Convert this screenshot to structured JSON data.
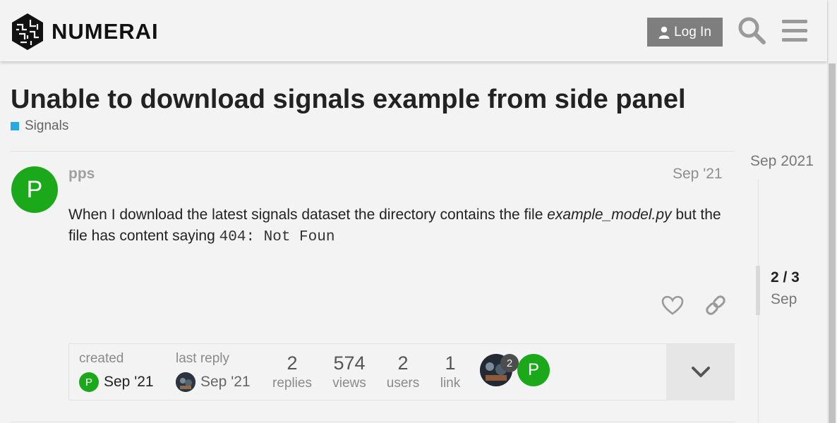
{
  "header": {
    "logo_text": "NUMERAI",
    "login_label": "Log In",
    "search_icon": "search-icon",
    "menu_icon": "hamburger-icon"
  },
  "topic": {
    "title": "Unable to download signals example from side panel",
    "category": "Signals",
    "category_color": "#25aae2"
  },
  "post": {
    "avatar_letter": "P",
    "username": "pps",
    "date": "Sep '21",
    "body_before": "When I download the latest signals dataset the directory contains the file ",
    "body_filename": "example_model.py",
    "body_middle": " but the file has content saying ",
    "body_code": "404: Not Foun"
  },
  "topic_map": {
    "created_label": "created",
    "created_avatar": "P",
    "created_date": "Sep '21",
    "last_reply_label": "last reply",
    "last_reply_date": "Sep '21",
    "stats": [
      {
        "num": "2",
        "label": "replies"
      },
      {
        "num": "574",
        "label": "views"
      },
      {
        "num": "2",
        "label": "users"
      },
      {
        "num": "1",
        "label": "link"
      }
    ],
    "participant_count": "2",
    "participant_letter": "P"
  },
  "timeline": {
    "start": "Sep 2021",
    "position": "2 / 3",
    "current_date": "Sep"
  },
  "colors": {
    "avatar_green": "#1ba91b",
    "button_gray": "#7e7e7e"
  }
}
